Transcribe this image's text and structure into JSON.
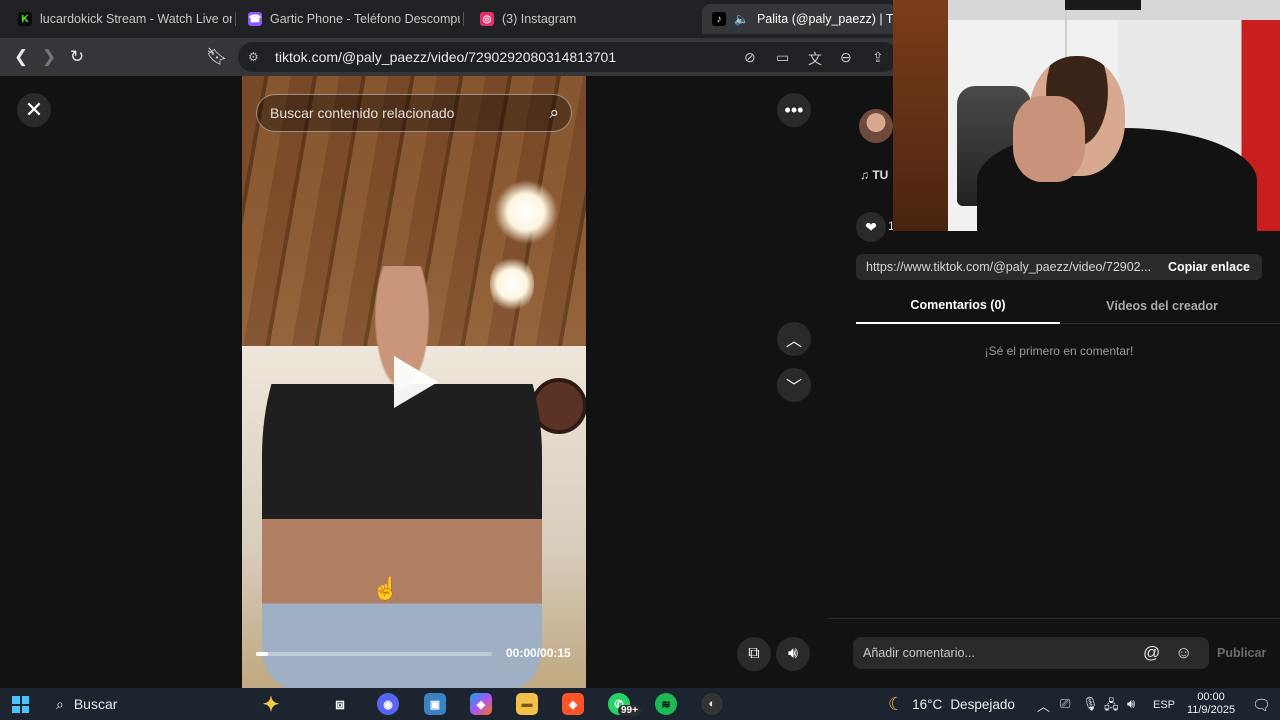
{
  "browser": {
    "tabs": [
      {
        "title": "lucardokick Stream - Watch Live on K",
        "fav_text": "K",
        "fav_color": "#53fc18"
      },
      {
        "title": "Gartic Phone - Teléfono Descompues",
        "fav_text": "☎",
        "fav_color": "#8b5cf6"
      },
      {
        "title": "(3) Instagram",
        "fav_text": "◎",
        "fav_color": "#e1306c"
      },
      {
        "title": "Palita (@paly_paezz) | TikTok",
        "fav_text": "♪",
        "fav_color": "#000000"
      }
    ],
    "url": "tiktok.com/@paly_paezz/video/7290292080314813701"
  },
  "video": {
    "search_placeholder": "Buscar contenido relacionado",
    "timecode": "00:00/00:15",
    "progress_fraction": 0.05
  },
  "panel": {
    "music_prefix": "♫ TU",
    "like_count_partial": "1",
    "share_url": "https://www.tiktok.com/@paly_paezz/video/72902...",
    "copy_link_label": "Copiar enlace",
    "tabs": [
      {
        "label": "Comentarios (0)",
        "active": true
      },
      {
        "label": "Vídeos del creador",
        "active": false
      }
    ],
    "empty_comments": "¡Sé el primero en comentar!",
    "comment_placeholder": "Añadir comentario...",
    "publish_label": "Publicar"
  },
  "taskbar": {
    "search_label": "Buscar",
    "badge": "99+",
    "weather_temp": "16°C",
    "weather_desc": "Despejado",
    "lang": "ESP",
    "time": "00:00",
    "date": "11/9/2025"
  },
  "colors": {
    "accent_brave": "#fb542b",
    "spotify": "#1db954",
    "whatsapp": "#25d366"
  }
}
